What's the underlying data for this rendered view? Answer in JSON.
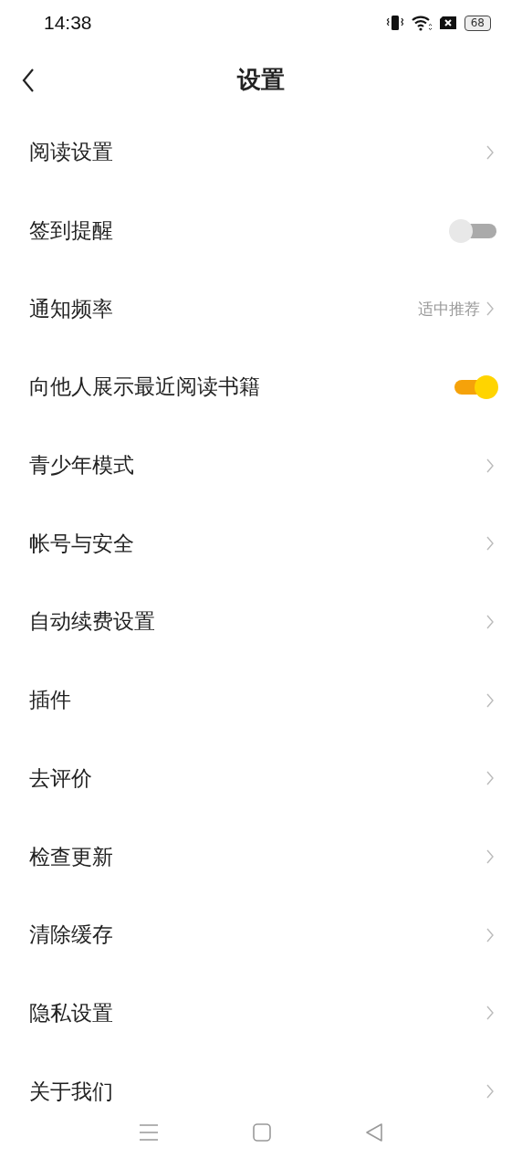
{
  "status_bar": {
    "time": "14:38",
    "battery": "68"
  },
  "header": {
    "title": "设置"
  },
  "items": [
    {
      "label": "阅读设置",
      "kind": "link"
    },
    {
      "label": "签到提醒",
      "kind": "toggle",
      "on": false
    },
    {
      "label": "通知频率",
      "kind": "link",
      "value": "适中推荐"
    },
    {
      "label": "向他人展示最近阅读书籍",
      "kind": "toggle",
      "on": true
    },
    {
      "label": "青少年模式",
      "kind": "link"
    },
    {
      "label": "帐号与安全",
      "kind": "link"
    },
    {
      "label": "自动续费设置",
      "kind": "link"
    },
    {
      "label": "插件",
      "kind": "link"
    },
    {
      "label": "去评价",
      "kind": "link"
    },
    {
      "label": "检查更新",
      "kind": "link"
    },
    {
      "label": "清除缓存",
      "kind": "link"
    },
    {
      "label": "隐私设置",
      "kind": "link"
    },
    {
      "label": "关于我们",
      "kind": "link"
    }
  ]
}
